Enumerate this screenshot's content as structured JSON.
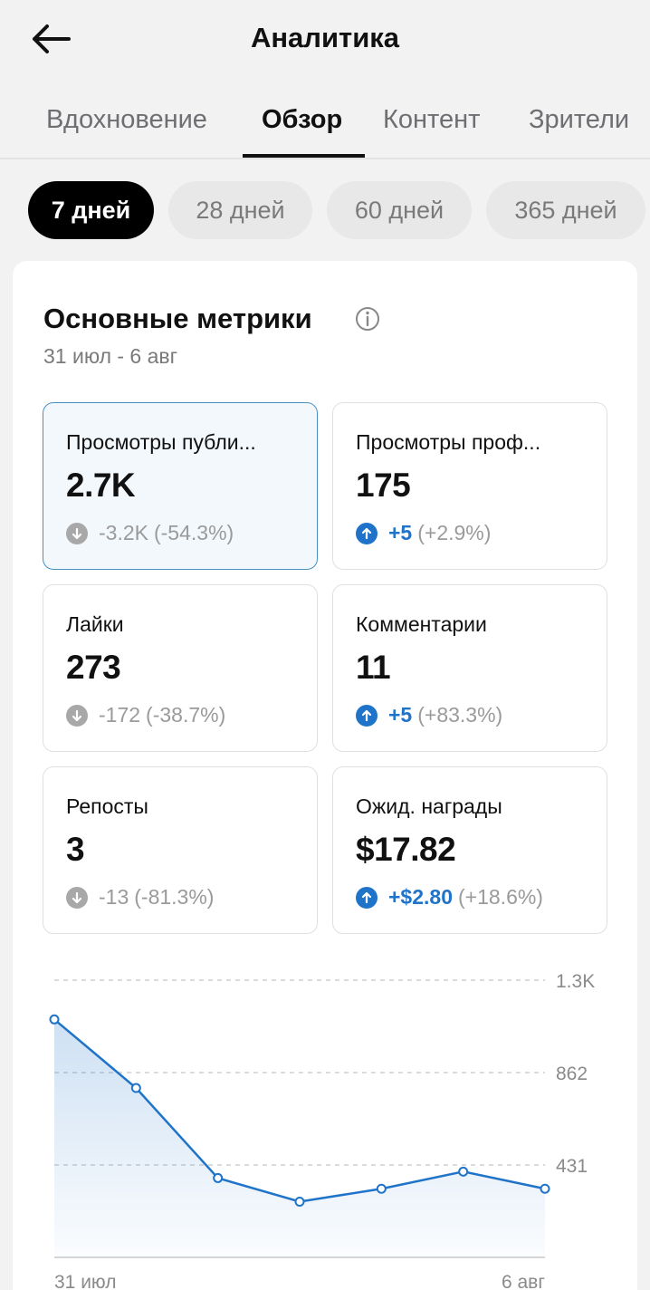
{
  "header": {
    "title": "Аналитика"
  },
  "tabs": [
    {
      "label": "Вдохновение",
      "active": false
    },
    {
      "label": "Обзор",
      "active": true
    },
    {
      "label": "Контент",
      "active": false
    },
    {
      "label": "Зрители",
      "active": false
    }
  ],
  "ranges": [
    {
      "label": "7 дней",
      "active": true
    },
    {
      "label": "28 дней",
      "active": false
    },
    {
      "label": "60 дней",
      "active": false
    },
    {
      "label": "365 дней",
      "active": false
    }
  ],
  "metrics_section": {
    "title": "Основные метрики",
    "date_range": "31 июл - 6 авг",
    "items": [
      {
        "label": "Просмотры публи...",
        "value": "2.7K",
        "direction": "down",
        "delta": "-3.2K",
        "percent": "(-54.3%)",
        "selected": true
      },
      {
        "label": "Просмотры проф...",
        "value": "175",
        "direction": "up",
        "delta": "+5",
        "percent": "(+2.9%)",
        "selected": false
      },
      {
        "label": "Лайки",
        "value": "273",
        "direction": "down",
        "delta": "-172",
        "percent": "(-38.7%)",
        "selected": false
      },
      {
        "label": "Комментарии",
        "value": "11",
        "direction": "up",
        "delta": "+5",
        "percent": "(+83.3%)",
        "selected": false
      },
      {
        "label": "Репосты",
        "value": "3",
        "direction": "down",
        "delta": "-13",
        "percent": "(-81.3%)",
        "selected": false
      },
      {
        "label": "Ожид. награды",
        "value": "$17.82",
        "direction": "up",
        "delta": "+$2.80",
        "percent": "(+18.6%)",
        "selected": false
      }
    ]
  },
  "colors": {
    "accent": "#1f74c9",
    "selected_bg": "#f3f8fc",
    "down": "#a8a8a8"
  },
  "chart_data": {
    "type": "area",
    "x_labels": [
      "31 июл",
      "6 авг"
    ],
    "y_ticks": [
      "431",
      "862",
      "1.3K"
    ],
    "ylim": [
      0,
      1293
    ],
    "values": [
      1110,
      790,
      370,
      260,
      320,
      400,
      320
    ],
    "color": "#1f74c9",
    "grid": true
  }
}
